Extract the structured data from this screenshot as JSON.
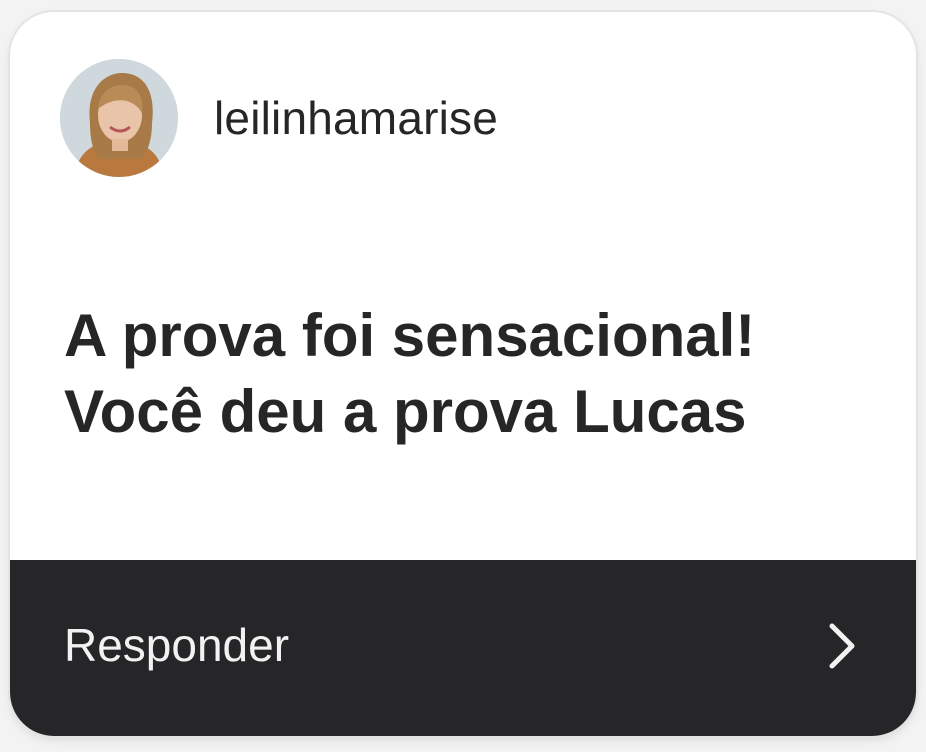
{
  "story_reply_card": {
    "username": "leilinhamarise",
    "message_lines": [
      "A prova foi sensacional!",
      "Você deu a prova Lucas"
    ],
    "reply_label": "Responder"
  },
  "icons": {
    "avatar": "profile-photo",
    "reply_arrow": "chevron-right-icon"
  },
  "colors": {
    "card_background": "#ffffff",
    "reply_bar_background": "#262629",
    "text_primary": "#262626",
    "reply_text": "#f2f2f2"
  }
}
